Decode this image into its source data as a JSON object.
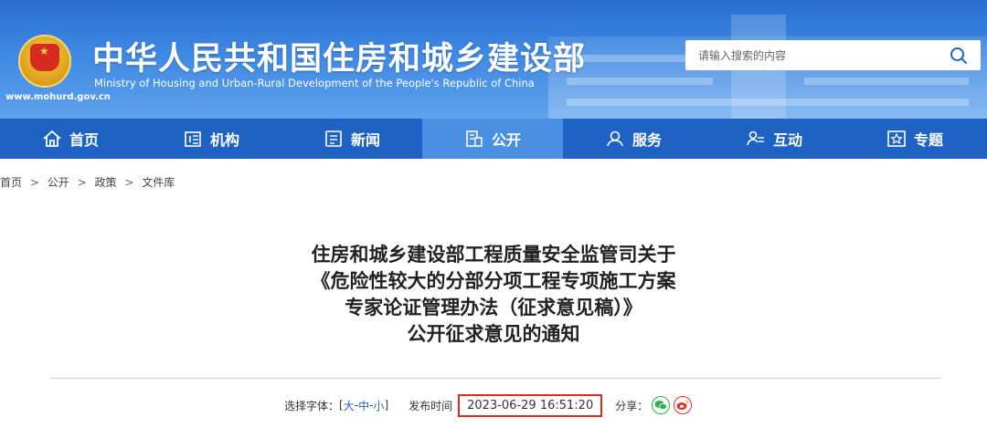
{
  "header": {
    "site_url": "www.mohurd.gov.cn",
    "title_cn": "中华人民共和国住房和城乡建设部",
    "title_en": "Ministry of Housing and Urban-Rural Development of the People's Republic of China",
    "search_placeholder": "请输入搜索的内容"
  },
  "nav": {
    "items": [
      {
        "label": "首页",
        "icon": "home-icon"
      },
      {
        "label": "机构",
        "icon": "building-icon"
      },
      {
        "label": "新闻",
        "icon": "news-icon"
      },
      {
        "label": "公开",
        "icon": "document-icon",
        "active": true
      },
      {
        "label": "服务",
        "icon": "service-icon"
      },
      {
        "label": "互动",
        "icon": "interaction-icon"
      },
      {
        "label": "专题",
        "icon": "star-icon"
      }
    ]
  },
  "breadcrumb": [
    "首页",
    "公开",
    "政策",
    "文件库"
  ],
  "breadcrumb_separator": ">",
  "article": {
    "title_lines": [
      "住房和城乡建设部工程质量安全监管司关于",
      "《危险性较大的分部分项工程专项施工方案",
      "专家论证管理办法（征求意见稿）》",
      "公开征求意见的通知"
    ],
    "font_select_label": "选择字体：",
    "font_bracket_open": "[",
    "font_bracket_close": "]",
    "font_sizes": [
      "大",
      "中",
      "小"
    ],
    "font_size_sep": "-",
    "publish_label": "发布时间",
    "publish_time": "2023-06-29 16:51:20",
    "share_label": "分享："
  },
  "colors": {
    "header_blue": "#2a6fd0",
    "nav_blue": "#1e63c3",
    "nav_active": "#4b8fe3",
    "highlight_red": "#e02a20",
    "wechat_green": "#2fb24b",
    "weibo_red": "#e0322d"
  }
}
